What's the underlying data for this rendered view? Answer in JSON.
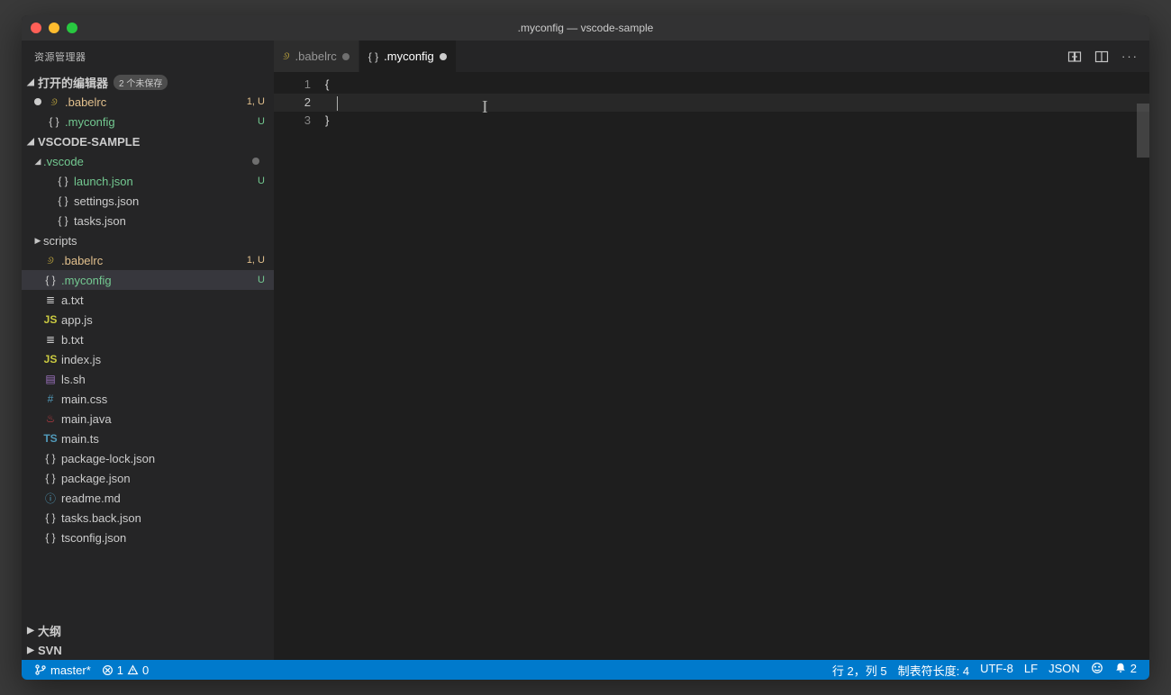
{
  "window": {
    "title": ".myconfig — vscode-sample"
  },
  "sidebar": {
    "title": "资源管理器",
    "openEditors": {
      "label": "打开的编辑器",
      "unsavedBadge": "2 个未保存",
      "items": [
        {
          "icon": "babel",
          "name": ".babelrc",
          "dirty": true,
          "decoration": "1, U",
          "gitStatus": "M",
          "dataName": "open-editor-babelrc"
        },
        {
          "icon": "json",
          "name": ".myconfig",
          "dirty": false,
          "decoration": "U",
          "gitStatus": "U",
          "dataName": "open-editor-myconfig"
        }
      ]
    },
    "workspace": {
      "label": "VSCODE-SAMPLE",
      "tree": [
        {
          "type": "folder",
          "name": ".vscode",
          "expanded": true,
          "gitStatus": "U",
          "dot": true,
          "depth": 0,
          "dataName": "tree-folder-vscode"
        },
        {
          "type": "file",
          "icon": "json",
          "name": "launch.json",
          "gitStatus": "U",
          "decoration": "U",
          "depth": 1,
          "dataName": "tree-file-launch-json"
        },
        {
          "type": "file",
          "icon": "json",
          "name": "settings.json",
          "depth": 1,
          "dataName": "tree-file-settings-json"
        },
        {
          "type": "file",
          "icon": "json",
          "name": "tasks.json",
          "depth": 1,
          "dataName": "tree-file-tasks-json"
        },
        {
          "type": "folder",
          "name": "scripts",
          "expanded": false,
          "depth": 0,
          "dataName": "tree-folder-scripts"
        },
        {
          "type": "file",
          "icon": "babel",
          "name": ".babelrc",
          "gitStatus": "M",
          "decoration": "1, U",
          "depth": 0,
          "dataName": "tree-file-babelrc"
        },
        {
          "type": "file",
          "icon": "json",
          "name": ".myconfig",
          "gitStatus": "U",
          "decoration": "U",
          "selected": true,
          "depth": 0,
          "dataName": "tree-file-myconfig"
        },
        {
          "type": "file",
          "icon": "txt",
          "name": "a.txt",
          "depth": 0,
          "dataName": "tree-file-a-txt"
        },
        {
          "type": "file",
          "icon": "js",
          "name": "app.js",
          "depth": 0,
          "dataName": "tree-file-app-js"
        },
        {
          "type": "file",
          "icon": "txt",
          "name": "b.txt",
          "depth": 0,
          "dataName": "tree-file-b-txt"
        },
        {
          "type": "file",
          "icon": "js",
          "name": "index.js",
          "depth": 0,
          "dataName": "tree-file-index-js"
        },
        {
          "type": "file",
          "icon": "sh",
          "name": "ls.sh",
          "depth": 0,
          "dataName": "tree-file-ls-sh"
        },
        {
          "type": "file",
          "icon": "hash",
          "name": "main.css",
          "depth": 0,
          "dataName": "tree-file-main-css"
        },
        {
          "type": "file",
          "icon": "java",
          "name": "main.java",
          "depth": 0,
          "dataName": "tree-file-main-java"
        },
        {
          "type": "file",
          "icon": "ts",
          "name": "main.ts",
          "depth": 0,
          "dataName": "tree-file-main-ts"
        },
        {
          "type": "file",
          "icon": "json",
          "name": "package-lock.json",
          "depth": 0,
          "dataName": "tree-file-package-lock-json"
        },
        {
          "type": "file",
          "icon": "json",
          "name": "package.json",
          "depth": 0,
          "dataName": "tree-file-package-json"
        },
        {
          "type": "file",
          "icon": "md",
          "name": "readme.md",
          "depth": 0,
          "dataName": "tree-file-readme-md"
        },
        {
          "type": "file",
          "icon": "json",
          "name": "tasks.back.json",
          "depth": 0,
          "dataName": "tree-file-tasks-back-json"
        },
        {
          "type": "file",
          "icon": "json",
          "name": "tsconfig.json",
          "depth": 0,
          "dataName": "tree-file-tsconfig-json"
        }
      ]
    },
    "outline": {
      "label": "大纲"
    },
    "svn": {
      "label": "SVN"
    }
  },
  "tabs": [
    {
      "icon": "babel",
      "name": ".babelrc",
      "dirty": true,
      "active": false,
      "dataName": "tab-babelrc"
    },
    {
      "icon": "json",
      "name": ".myconfig",
      "dirty": true,
      "active": true,
      "dataName": "tab-myconfig"
    }
  ],
  "editor": {
    "lines": [
      {
        "num": "1",
        "text": "{"
      },
      {
        "num": "2",
        "text": "    ",
        "current": true
      },
      {
        "num": "3",
        "text": "}"
      }
    ]
  },
  "statusbar": {
    "branch": "master*",
    "errors": "1",
    "warnings": "0",
    "position": "行 2，列 5",
    "tabSize": "制表符长度: 4",
    "encoding": "UTF-8",
    "eol": "LF",
    "language": "JSON",
    "notifications": "2"
  },
  "iconGlyphs": {
    "babel": "୬",
    "json": "{ }",
    "js": "JS",
    "ts": "TS",
    "sh": "▤",
    "hash": "#",
    "java": "♨",
    "md": "ⓘ",
    "txt": "≣"
  }
}
